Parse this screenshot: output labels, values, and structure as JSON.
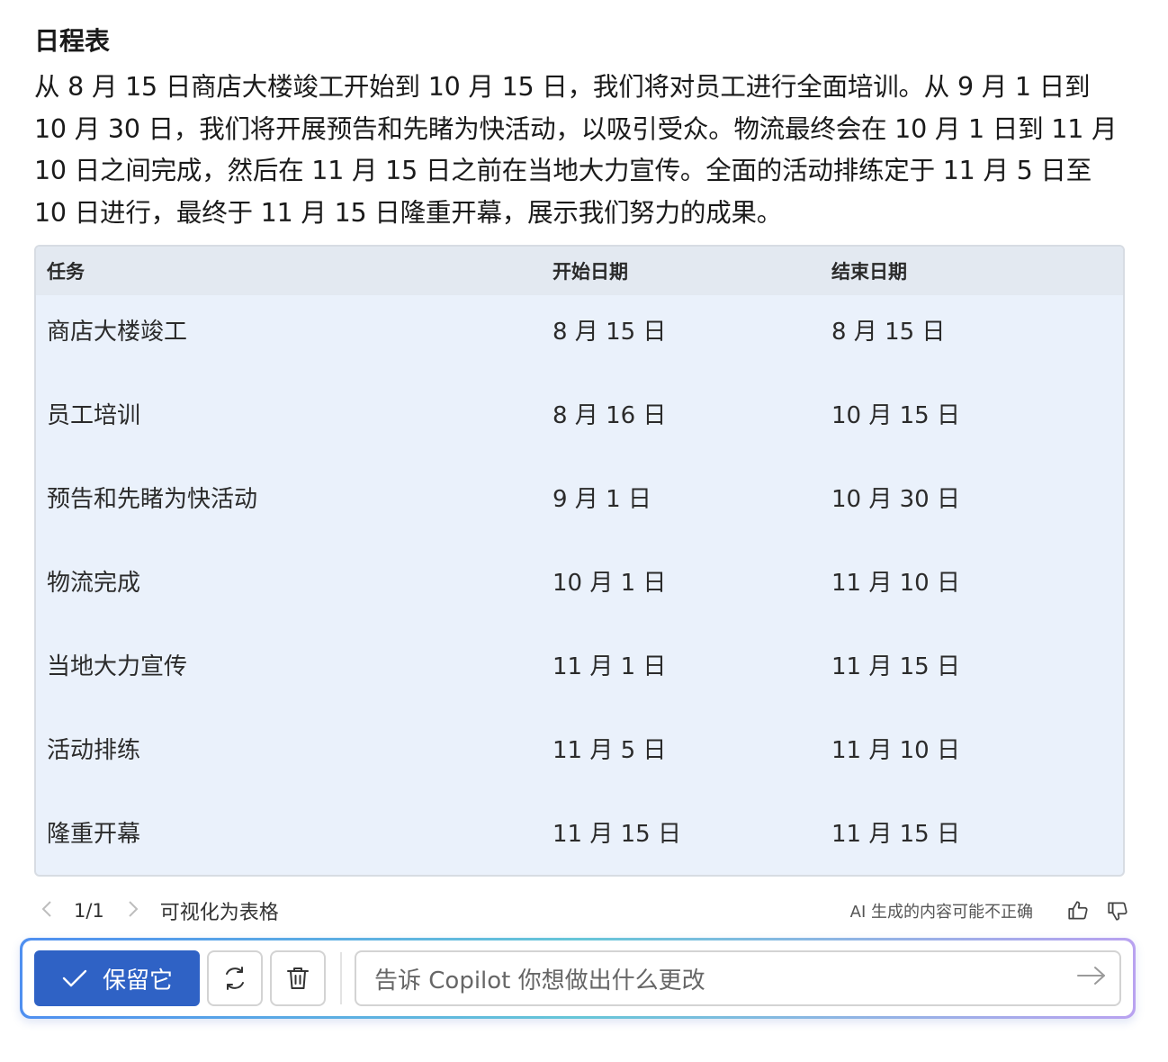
{
  "heading": "日程表",
  "paragraph": "从 8 月 15 日商店大楼竣工开始到 10 月 15 日，我们将对员工进行全面培训。从 9 月 1 日到 10 月 30 日，我们将开展预告和先睹为快活动，以吸引受众。物流最终会在 10 月 1 日到 11 月 10 日之间完成，然后在 11 月 15 日之前在当地大力宣传。全面的活动排练定于 11 月 5 日至 10 日进行，最终于 11 月 15 日隆重开幕，展示我们努力的成果。",
  "table": {
    "headers": [
      "任务",
      "开始日期",
      "结束日期"
    ],
    "rows": [
      [
        "商店大楼竣工",
        "8 月 15 日",
        "8 月 15 日"
      ],
      [
        "员工培训",
        "8 月 16 日",
        "10 月 15 日"
      ],
      [
        "预告和先睹为快活动",
        "9 月 1 日",
        "10 月 30 日"
      ],
      [
        "物流完成",
        "10 月 1 日",
        "11 月 10 日"
      ],
      [
        "当地大力宣传",
        "11 月 1 日",
        "11 月 15 日"
      ],
      [
        "活动排练",
        "11 月 5 日",
        "11 月 10 日"
      ],
      [
        "隆重开幕",
        "11 月 15 日",
        "11 月 15 日"
      ]
    ]
  },
  "footer": {
    "pager": "1/1",
    "visualize": "可视化为表格",
    "disclaimer": "AI 生成的内容可能不正确"
  },
  "actions": {
    "keep_label": "保留它",
    "prompt_placeholder": "告诉 Copilot 你想做出什么更改"
  },
  "colors": {
    "accent": "#2f62c5",
    "table_bg": "#eaf1fb",
    "table_header_bg": "#e3e9f1"
  }
}
